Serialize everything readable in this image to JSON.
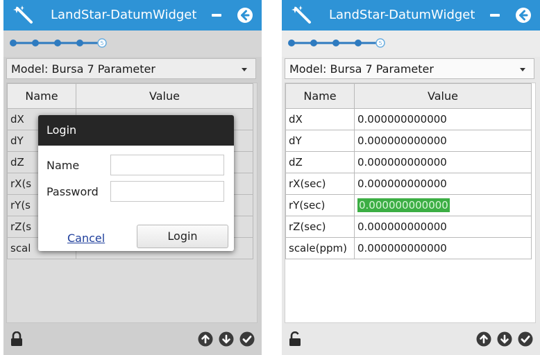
{
  "app": {
    "title": "LandStar-DatumWidget",
    "accent_color": "#2e93d6",
    "icons": [
      "wand-icon",
      "minimize-icon",
      "back-arrow-icon",
      "lock-icon",
      "up-arrow-icon",
      "down-arrow-icon",
      "check-icon"
    ]
  },
  "steps": {
    "total": 5,
    "current": 5,
    "last_label": "5"
  },
  "model": {
    "label": "Model:",
    "value": "Bursa 7 Parameter"
  },
  "table": {
    "headers": {
      "name": "Name",
      "value": "Value"
    },
    "rows": [
      {
        "name": "dX",
        "value": "0.000000000000"
      },
      {
        "name": "dY",
        "value": "0.000000000000"
      },
      {
        "name": "dZ",
        "value": "0.000000000000"
      },
      {
        "name": "rX(sec)",
        "value": "0.000000000000"
      },
      {
        "name": "rY(sec)",
        "value": "0.000000000000"
      },
      {
        "name": "rZ(sec)",
        "value": "0.000000000000"
      },
      {
        "name": "scale(ppm)",
        "value": "0.000000000000"
      }
    ],
    "selected_row": 4,
    "selected_color": "#3cae44"
  },
  "left_table_names": [
    "dX",
    "dY",
    "dZ",
    "rX(s",
    "rY(s",
    "rZ(s",
    "scal"
  ],
  "login": {
    "title": "Login",
    "name_label": "Name",
    "password_label": "Password",
    "name_value": "",
    "password_value": "",
    "cancel_label": "Cancel",
    "login_label": "Login"
  },
  "lock_state": {
    "left": "locked",
    "right": "unlocked"
  }
}
